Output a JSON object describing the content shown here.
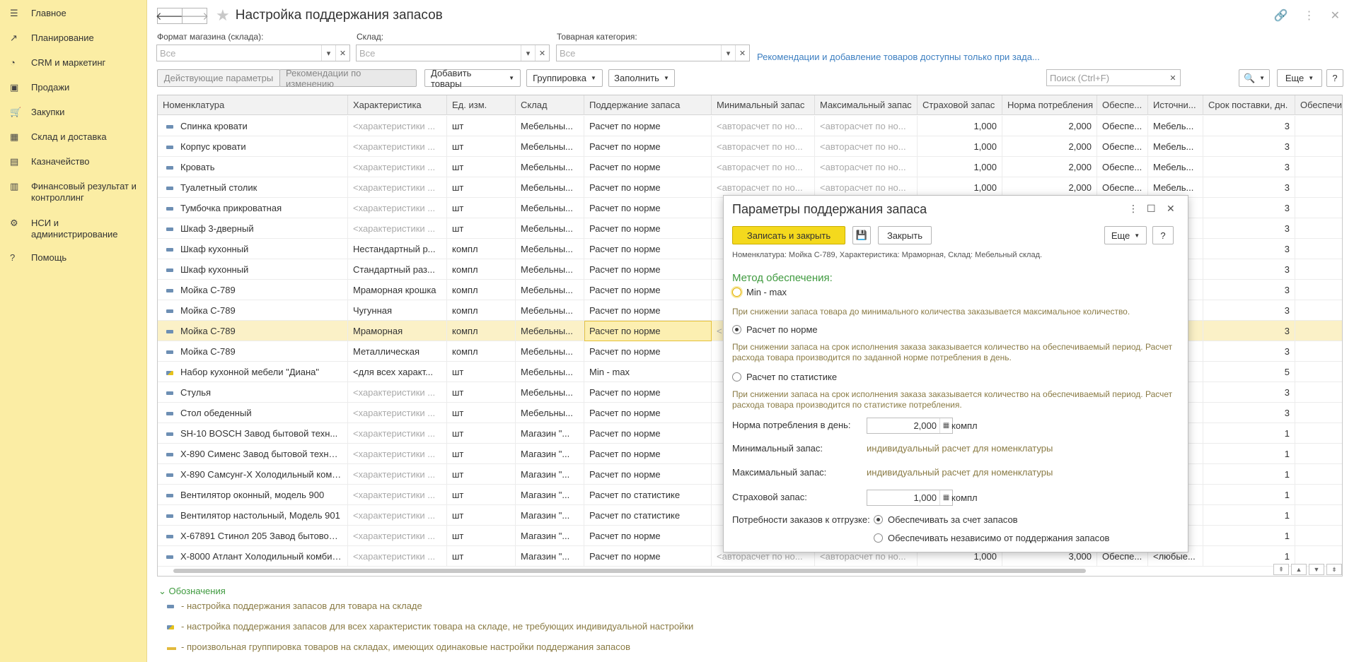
{
  "sidebar": {
    "items": [
      {
        "icon": "menu-icon",
        "glyph": "☰",
        "label": "Главное"
      },
      {
        "icon": "planning-icon",
        "glyph": "↗",
        "label": "Планирование"
      },
      {
        "icon": "crm-icon",
        "glyph": "◔",
        "label": "CRM и маркетинг"
      },
      {
        "icon": "bag-icon",
        "glyph": "▣",
        "label": "Продажи"
      },
      {
        "icon": "cart-icon",
        "glyph": "🛒",
        "label": "Закупки"
      },
      {
        "icon": "warehouse-icon",
        "glyph": "▦",
        "label": "Склад и доставка"
      },
      {
        "icon": "treasury-icon",
        "glyph": "▤",
        "label": "Казначейство"
      },
      {
        "icon": "chart-icon",
        "glyph": "▥",
        "label": "Финансовый результат и контроллинг"
      },
      {
        "icon": "gear-icon",
        "glyph": "⚙",
        "label": "НСИ и администрирование"
      },
      {
        "icon": "help-icon",
        "glyph": "?",
        "label": "Помощь"
      }
    ]
  },
  "header": {
    "title": "Настройка поддержания запасов"
  },
  "filters": {
    "store_format": {
      "label": "Формат магазина (склада):",
      "value": "Все"
    },
    "warehouse": {
      "label": "Склад:",
      "value": "Все"
    },
    "category": {
      "label": "Товарная категория:",
      "value": "Все"
    },
    "recommendation_link": "Рекомендации и добавление товаров доступны только при зада..."
  },
  "toolbar": {
    "current_params": "Действующие параметры",
    "recommendations": "Рекомендации по изменению",
    "add_goods": "Добавить товары",
    "grouping": "Группировка",
    "fill": "Заполнить",
    "search_placeholder": "Поиск (Ctrl+F)",
    "more": "Еще",
    "help": "?"
  },
  "table": {
    "columns": [
      "Номенклатура",
      "Характеристика",
      "Ед. изм.",
      "Склад",
      "Поддержание запаса",
      "Минимальный запас",
      "Максимальный запас",
      "Страховой запас",
      "Норма потребления",
      "Обеспе...",
      "Источни...",
      "Срок поставки, дн.",
      "Обеспечив"
    ],
    "rows": [
      {
        "icon": "item",
        "name": "Спинка кровати",
        "char": "<характеристики ...",
        "char_ph": true,
        "unit": "шт",
        "wh": "Мебельны...",
        "method": "Расчет по норме",
        "min": "<авторасчет по но...",
        "max": "<авторасчет по но...",
        "safety": "1,000",
        "norm": "2,000",
        "prov": "Обеспе...",
        "src": "Мебель...",
        "lead": "3"
      },
      {
        "icon": "item",
        "name": "Корпус кровати",
        "char": "<характеристики ...",
        "char_ph": true,
        "unit": "шт",
        "wh": "Мебельны...",
        "method": "Расчет по норме",
        "min": "<авторасчет по но...",
        "max": "<авторасчет по но...",
        "safety": "1,000",
        "norm": "2,000",
        "prov": "Обеспе...",
        "src": "Мебель...",
        "lead": "3"
      },
      {
        "icon": "item",
        "name": "Кровать",
        "char": "<характеристики ...",
        "char_ph": true,
        "unit": "шт",
        "wh": "Мебельны...",
        "method": "Расчет по норме",
        "min": "<авторасчет по но...",
        "max": "<авторасчет по но...",
        "safety": "1,000",
        "norm": "2,000",
        "prov": "Обеспе...",
        "src": "Мебель...",
        "lead": "3"
      },
      {
        "icon": "item",
        "name": "Туалетный столик",
        "char": "<характеристики ...",
        "char_ph": true,
        "unit": "шт",
        "wh": "Мебельны...",
        "method": "Расчет по норме",
        "min": "<авторасчет по но...",
        "max": "<авторасчет по но...",
        "safety": "1,000",
        "norm": "2,000",
        "prov": "Обеспе...",
        "src": "Мебель...",
        "lead": "3"
      },
      {
        "icon": "item",
        "name": "Тумбочка прикроватная",
        "char": "<характеристики ...",
        "char_ph": true,
        "unit": "шт",
        "wh": "Мебельны...",
        "method": "Расчет по норме",
        "min": "",
        "max": "",
        "safety": "",
        "norm": "",
        "prov": "",
        "src": "",
        "lead": "3"
      },
      {
        "icon": "item",
        "name": "Шкаф 3-дверный",
        "char": "<характеристики ...",
        "char_ph": true,
        "unit": "шт",
        "wh": "Мебельны...",
        "method": "Расчет по норме",
        "min": "",
        "max": "",
        "safety": "",
        "norm": "",
        "prov": "",
        "src": "",
        "lead": "3"
      },
      {
        "icon": "item",
        "name": "Шкаф кухонный",
        "char": "Нестандартный р...",
        "char_ph": false,
        "unit": "компл",
        "wh": "Мебельны...",
        "method": "Расчет по норме",
        "min": "",
        "max": "",
        "safety": "",
        "norm": "",
        "prov": "",
        "src": "",
        "lead": "3"
      },
      {
        "icon": "item",
        "name": "Шкаф кухонный",
        "char": "Стандартный раз...",
        "char_ph": false,
        "unit": "компл",
        "wh": "Мебельны...",
        "method": "Расчет по норме",
        "min": "",
        "max": "",
        "safety": "",
        "norm": "",
        "prov": "",
        "src": "",
        "lead": "3"
      },
      {
        "icon": "item",
        "name": "Мойка С-789",
        "char": "Мраморная крошка",
        "char_ph": false,
        "unit": "компл",
        "wh": "Мебельны...",
        "method": "Расчет по норме",
        "min": "",
        "max": "",
        "safety": "",
        "norm": "",
        "prov": "",
        "src": "",
        "lead": "3"
      },
      {
        "icon": "item",
        "name": "Мойка С-789",
        "char": "Чугунная",
        "char_ph": false,
        "unit": "компл",
        "wh": "Мебельны...",
        "method": "Расчет по норме",
        "min": "",
        "max": "",
        "safety": "",
        "norm": "",
        "prov": "",
        "src": "",
        "lead": "3"
      },
      {
        "icon": "item",
        "name": "Мойка С-789",
        "char": "Мраморная",
        "char_ph": false,
        "unit": "компл",
        "wh": "Мебельны...",
        "method": "Расчет по норме",
        "min": "<",
        "max": "",
        "safety": "",
        "norm": "",
        "prov": "",
        "src": "",
        "lead": "3",
        "selected": true
      },
      {
        "icon": "item",
        "name": "Мойка С-789",
        "char": "Металлическая",
        "char_ph": false,
        "unit": "компл",
        "wh": "Мебельны...",
        "method": "Расчет по норме",
        "min": "",
        "max": "",
        "safety": "",
        "norm": "",
        "prov": "",
        "src": "",
        "lead": "3"
      },
      {
        "icon": "mix",
        "name": "Набор кухонной мебели \"Диана\"",
        "char": "<для всех характ...",
        "char_ph": false,
        "unit": "шт",
        "wh": "Мебельны...",
        "method": "Min - max",
        "min": "",
        "max": "",
        "safety": "",
        "norm": "",
        "prov": "",
        "src": "",
        "lead": "5"
      },
      {
        "icon": "item",
        "name": "Стулья",
        "char": "<характеристики ...",
        "char_ph": true,
        "unit": "шт",
        "wh": "Мебельны...",
        "method": "Расчет по норме",
        "min": "",
        "max": "",
        "safety": "",
        "norm": "",
        "prov": "",
        "src": "",
        "lead": "3"
      },
      {
        "icon": "item",
        "name": "Стол обеденный",
        "char": "<характеристики ...",
        "char_ph": true,
        "unit": "шт",
        "wh": "Мебельны...",
        "method": "Расчет по норме",
        "min": "",
        "max": "",
        "safety": "",
        "norm": "",
        "prov": "",
        "src": "",
        "lead": "3"
      },
      {
        "icon": "item",
        "name": "SH-10 BOSCH Завод бытовой техн...",
        "char": "<характеристики ...",
        "char_ph": true,
        "unit": "шт",
        "wh": "Магазин \"...",
        "method": "Расчет по норме",
        "min": "",
        "max": "",
        "safety": "",
        "norm": "",
        "prov": "",
        "src": "",
        "lead": "1"
      },
      {
        "icon": "item",
        "name": "X-890 Сименс Завод бытовой техники",
        "char": "<характеристики ...",
        "char_ph": true,
        "unit": "шт",
        "wh": "Магазин \"...",
        "method": "Расчет по норме",
        "min": "",
        "max": "",
        "safety": "",
        "norm": "",
        "prov": "",
        "src": "",
        "lead": "1"
      },
      {
        "icon": "item",
        "name": "X-890 Самсунг-Х Холодильный комб...",
        "char": "<характеристики ...",
        "char_ph": true,
        "unit": "шт",
        "wh": "Магазин \"...",
        "method": "Расчет по норме",
        "min": "",
        "max": "",
        "safety": "",
        "norm": "",
        "prov": "",
        "src": "",
        "lead": "1"
      },
      {
        "icon": "item",
        "name": "Вентилятор оконный, модель 900",
        "char": "<характеристики ...",
        "char_ph": true,
        "unit": "шт",
        "wh": "Магазин \"...",
        "method": "Расчет по статистике",
        "min": "",
        "max": "",
        "safety": "",
        "norm": "",
        "prov": "",
        "src": "",
        "lead": "1"
      },
      {
        "icon": "item",
        "name": "Вентилятор настольный, Модель 901",
        "char": "<характеристики ...",
        "char_ph": true,
        "unit": "шт",
        "wh": "Магазин \"...",
        "method": "Расчет по статистике",
        "min": "",
        "max": "",
        "safety": "",
        "norm": "",
        "prov": "",
        "src": "",
        "lead": "1"
      },
      {
        "icon": "item",
        "name": "X-67891 Стинол 205 Завод бытовой ...",
        "char": "<характеристики ...",
        "char_ph": true,
        "unit": "шт",
        "wh": "Магазин \"...",
        "method": "Расчет по норме",
        "min": "",
        "max": "",
        "safety": "",
        "norm": "",
        "prov": "",
        "src": "",
        "lead": "1"
      },
      {
        "icon": "item",
        "name": "X-8000 Атлант Холодильный комбинат",
        "char": "<характеристики ...",
        "char_ph": true,
        "unit": "шт",
        "wh": "Магазин \"...",
        "method": "Расчет по норме",
        "min": "<авторасчет по но...",
        "max": "<авторасчет по но...",
        "safety": "1,000",
        "norm": "3,000",
        "prov": "Обеспе...",
        "src": "<любые...",
        "lead": "1"
      }
    ]
  },
  "legend": {
    "title": "Обозначения",
    "items": [
      "- настройка поддержания запасов для товара на складе",
      "- настройка поддержания запасов для всех характеристик товара на складе, не требующих индивидуальной настройки",
      "- произвольная группировка товаров на складах, имеющих одинаковые настройки поддержания запасов"
    ]
  },
  "dialog": {
    "title": "Параметры поддержания запаса",
    "save_close": "Записать и закрыть",
    "close": "Закрыть",
    "more": "Еще",
    "help": "?",
    "context": "Номенклатура: Мойка С-789, Характеристика: Мраморная, Склад: Мебельный склад.",
    "method_title": "Метод обеспечения:",
    "opt_minmax": "Min - max",
    "hint_minmax": "При снижении запаса товара до минимального количества заказывается максимальное количество.",
    "opt_norm": "Расчет по норме",
    "hint_norm": "При снижении запаса на срок исполнения заказа заказывается количество на обеспечиваемый период. Расчет расхода товара производится по заданной норме потребления в день.",
    "opt_stat": "Расчет по статистике",
    "hint_stat": "При снижении запаса на срок исполнения заказа заказывается количество на обеспечиваемый период. Расчет расхода товара производится по статистике потребления.",
    "norm_label": "Норма потребления в день:",
    "norm_value": "2,000",
    "unit": "компл",
    "min_label": "Минимальный запас:",
    "min_value": "индивидуальный расчет для номенклатуры",
    "max_label": "Максимальный запас:",
    "max_value": "индивидуальный расчет для номенклатуры",
    "safety_label": "Страховой запас:",
    "safety_value": "1,000",
    "orders_label": "Потребности заказов к отгрузке:",
    "orders_opt1": "Обеспечивать за счет запасов",
    "orders_opt2": "Обеспечивать независимо от поддержания запасов"
  }
}
